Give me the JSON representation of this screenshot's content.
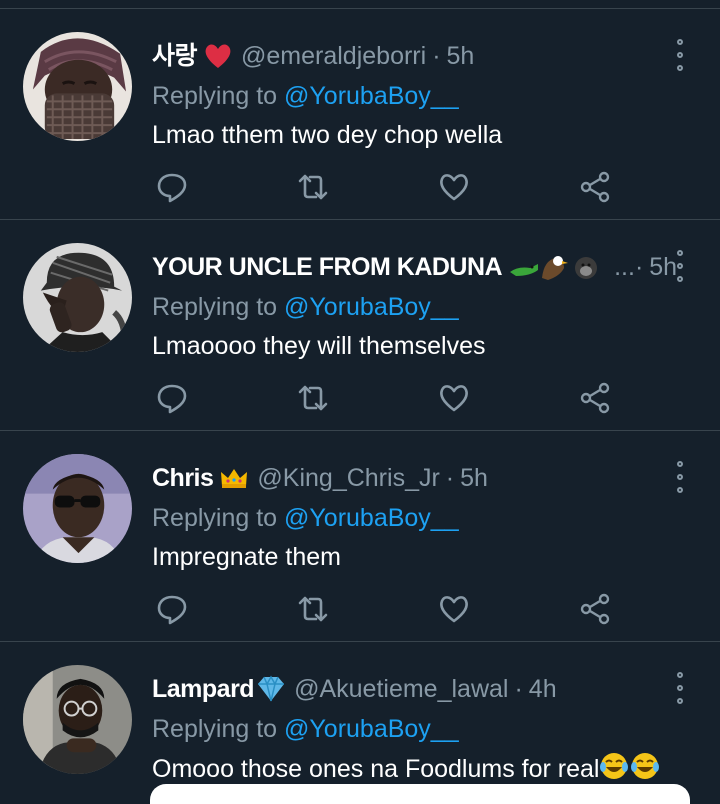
{
  "tweets": [
    {
      "name": "사랑",
      "badge_icon": "red-heart-emoji",
      "handle": "@emeraldjeborri",
      "separator": "·",
      "time": "5h",
      "replying_prefix": "Replying to",
      "replying_to": "@YorubaBoy__",
      "text": "Lmao tthem two dey chop wella"
    },
    {
      "name": "YOUR UNCLE FROM KADUNA",
      "badge_icon": "crocodile-eagle-gorilla-emoji",
      "handle": "...",
      "separator": "·",
      "time": "5h",
      "replying_prefix": "Replying to",
      "replying_to": "@YorubaBoy__",
      "text": "Lmaoooo they will themselves"
    },
    {
      "name": "Chris",
      "badge_icon": "crown-emoji",
      "handle": "@King_Chris_Jr",
      "separator": "·",
      "time": "5h",
      "replying_prefix": "Replying to",
      "replying_to": "@YorubaBoy__",
      "text": "Impregnate them"
    },
    {
      "name": "Lampard",
      "badge_icon": "gem-emoji",
      "handle": "@Akuetieme_lawal",
      "separator": "·",
      "time": "4h",
      "replying_prefix": "Replying to",
      "replying_to": "@YorubaBoy__",
      "text": "Omooo those ones na Foodlums for real"
    }
  ],
  "action_icons": [
    "reply-icon",
    "retweet-icon",
    "like-icon",
    "share-icon"
  ],
  "colors": {
    "background": "#15202b",
    "divider": "#38444d",
    "secondary_text": "#8899a6",
    "link": "#1da1f2",
    "primary_text": "#ffffff"
  }
}
